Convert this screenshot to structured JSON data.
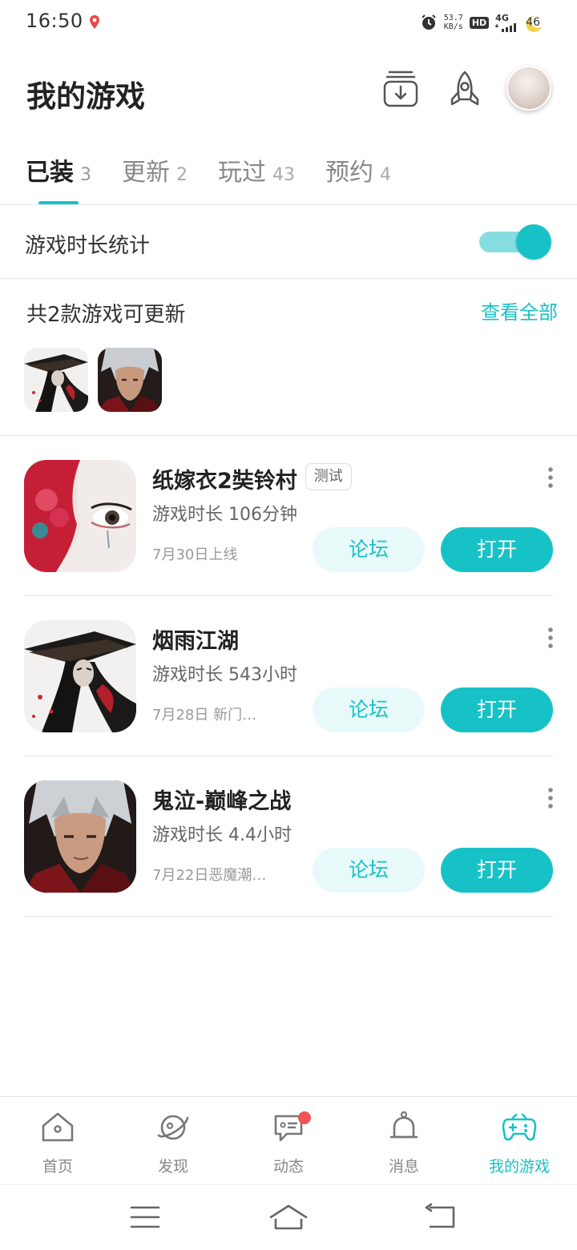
{
  "status_bar": {
    "time": "16:50",
    "speed_value": "53.7",
    "speed_unit": "KB/s",
    "hd": "HD",
    "network": "4G",
    "battery": "46"
  },
  "header": {
    "title": "我的游戏"
  },
  "tabs": [
    {
      "label": "已装",
      "count": "3",
      "active": true
    },
    {
      "label": "更新",
      "count": "2",
      "active": false
    },
    {
      "label": "玩过",
      "count": "43",
      "active": false
    },
    {
      "label": "预约",
      "count": "4",
      "active": false
    }
  ],
  "stats": {
    "label": "游戏时长统计",
    "enabled": true
  },
  "updates": {
    "title": "共2款游戏可更新",
    "view_all": "查看全部"
  },
  "games": [
    {
      "name": "纸嫁衣2奘铃村",
      "badge": "测试",
      "playtime": "游戏时长 106分钟",
      "date": "7月30日上线",
      "forum": "论坛",
      "open": "打开"
    },
    {
      "name": "烟雨江湖",
      "badge": "",
      "playtime": "游戏时长 543小时",
      "date": "7月28日 新门…",
      "forum": "论坛",
      "open": "打开"
    },
    {
      "name": "鬼泣-巅峰之战",
      "badge": "",
      "playtime": "游戏时长 4.4小时",
      "date": "7月22日恶魔潮…",
      "forum": "论坛",
      "open": "打开"
    }
  ],
  "bottom_nav": [
    {
      "label": "首页",
      "icon": "home-icon",
      "active": false
    },
    {
      "label": "发现",
      "icon": "planet-icon",
      "active": false
    },
    {
      "label": "动态",
      "icon": "chat-icon",
      "active": false,
      "badge_dot": true
    },
    {
      "label": "消息",
      "icon": "bell-icon",
      "active": false
    },
    {
      "label": "我的游戏",
      "icon": "gamepad-icon",
      "active": true
    }
  ],
  "colors": {
    "accent": "#17c2c7",
    "accent_light": "#e8f9fa",
    "badge_red": "#f05454"
  }
}
